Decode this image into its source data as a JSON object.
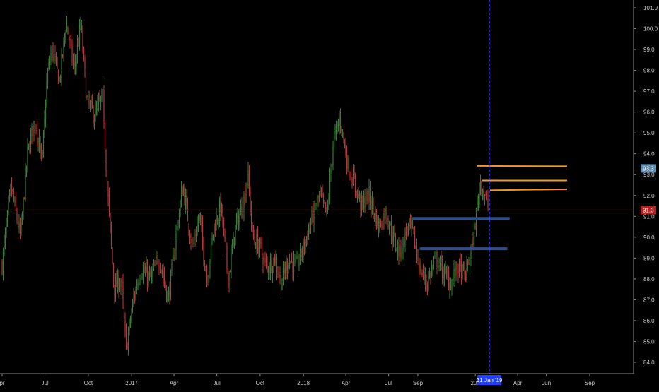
{
  "chart_data": {
    "type": "candlestick",
    "instrument_hint": "",
    "title": "",
    "xlabel": "",
    "ylabel": "",
    "y_range": [
      83.6,
      101.3
    ],
    "x_range": [
      "2016-04-01",
      "2019-09-30"
    ],
    "x_ticks": [
      {
        "label": "pr",
        "date": "2016-04-01"
      },
      {
        "label": "Jul",
        "date": "2016-07-01"
      },
      {
        "label": "Oct",
        "date": "2016-10-01"
      },
      {
        "label": "2017",
        "date": "2017-01-01"
      },
      {
        "label": "Apr",
        "date": "2017-04-01"
      },
      {
        "label": "Jul",
        "date": "2017-07-01"
      },
      {
        "label": "Oct",
        "date": "2017-10-01"
      },
      {
        "label": "2018",
        "date": "2018-01-01"
      },
      {
        "label": "Apr",
        "date": "2018-04-01"
      },
      {
        "label": "Jul",
        "date": "2018-07-01"
      },
      {
        "label": "Sep",
        "date": "2018-09-01"
      },
      {
        "label": "201",
        "date": "2019-01-01"
      },
      {
        "label": "Apr",
        "date": "2019-04-01"
      },
      {
        "label": "Jun",
        "date": "2019-06-01"
      },
      {
        "label": "Sep",
        "date": "2019-09-01"
      }
    ],
    "y_ticks": [
      84.0,
      85.0,
      86.0,
      87.0,
      88.0,
      89.0,
      90.0,
      91.0,
      92.0,
      93.0,
      94.0,
      95.0,
      96.0,
      97.0,
      98.0,
      99.0,
      100.0,
      101.0
    ],
    "price_path": [
      [
        "2016-04-01",
        88.7
      ],
      [
        "2016-04-20",
        92.4
      ],
      [
        "2016-05-10",
        90.0
      ],
      [
        "2016-05-25",
        94.0
      ],
      [
        "2016-06-10",
        95.7
      ],
      [
        "2016-06-25",
        93.5
      ],
      [
        "2016-07-05",
        97.5
      ],
      [
        "2016-07-15",
        99.0
      ],
      [
        "2016-08-01",
        97.5
      ],
      [
        "2016-08-15",
        100.3
      ],
      [
        "2016-09-01",
        98.0
      ],
      [
        "2016-09-15",
        100.2
      ],
      [
        "2016-09-28",
        96.5
      ],
      [
        "2016-10-15",
        95.8
      ],
      [
        "2016-11-01",
        96.8
      ],
      [
        "2016-11-10",
        92.5
      ],
      [
        "2016-11-25",
        87.5
      ],
      [
        "2016-12-10",
        88.0
      ],
      [
        "2016-12-20",
        84.6
      ],
      [
        "2017-01-05",
        87.0
      ],
      [
        "2017-01-20",
        88.5
      ],
      [
        "2017-02-10",
        88.0
      ],
      [
        "2017-03-01",
        89.0
      ],
      [
        "2017-03-20",
        87.0
      ],
      [
        "2017-04-05",
        90.0
      ],
      [
        "2017-04-20",
        92.5
      ],
      [
        "2017-05-10",
        89.5
      ],
      [
        "2017-05-25",
        91.0
      ],
      [
        "2017-06-10",
        88.0
      ],
      [
        "2017-06-25",
        90.5
      ],
      [
        "2017-07-10",
        91.5
      ],
      [
        "2017-07-25",
        88.0
      ],
      [
        "2017-08-10",
        90.5
      ],
      [
        "2017-08-25",
        91.5
      ],
      [
        "2017-09-05",
        93.0
      ],
      [
        "2017-09-15",
        90.0
      ],
      [
        "2017-10-01",
        89.5
      ],
      [
        "2017-10-15",
        88.5
      ],
      [
        "2017-11-01",
        89.0
      ],
      [
        "2017-11-15",
        87.8
      ],
      [
        "2017-12-01",
        89.0
      ],
      [
        "2017-12-15",
        88.5
      ],
      [
        "2018-01-01",
        89.5
      ],
      [
        "2018-01-20",
        91.0
      ],
      [
        "2018-02-05",
        92.0
      ],
      [
        "2018-02-20",
        91.0
      ],
      [
        "2018-03-05",
        94.5
      ],
      [
        "2018-03-20",
        95.7
      ],
      [
        "2018-04-05",
        93.5
      ],
      [
        "2018-04-20",
        92.5
      ],
      [
        "2018-05-05",
        91.5
      ],
      [
        "2018-05-20",
        92.0
      ],
      [
        "2018-06-10",
        90.5
      ],
      [
        "2018-06-25",
        91.3
      ],
      [
        "2018-07-10",
        90.0
      ],
      [
        "2018-07-25",
        89.2
      ],
      [
        "2018-08-10",
        90.5
      ],
      [
        "2018-08-20",
        90.3
      ],
      [
        "2018-09-05",
        88.5
      ],
      [
        "2018-09-20",
        87.8
      ],
      [
        "2018-10-10",
        89.0
      ],
      [
        "2018-10-25",
        88.3
      ],
      [
        "2018-11-10",
        87.8
      ],
      [
        "2018-11-25",
        88.6
      ],
      [
        "2018-12-10",
        88.1
      ],
      [
        "2018-12-25",
        89.5
      ],
      [
        "2019-01-05",
        91.5
      ],
      [
        "2019-01-12",
        92.8
      ],
      [
        "2019-01-20",
        92.0
      ],
      [
        "2019-01-31",
        91.3
      ]
    ],
    "annotations": {
      "current_price": 91.3,
      "current_price_label": "91.3",
      "last_close_label": "93.3",
      "last_close": 93.3,
      "date_cursor_label": "31 Jan '19",
      "date_cursor": "2019-01-31",
      "horizontal_rays": [
        {
          "kind": "resistance",
          "color": "#f7931e",
          "start": "2019-01-05",
          "end": "2019-07-15",
          "y_start": 93.42,
          "y_end": 93.4
        },
        {
          "kind": "resistance",
          "color": "#f7931e",
          "start": "2019-01-15",
          "end": "2019-07-15",
          "y_start": 92.72,
          "y_end": 92.72
        },
        {
          "kind": "resistance",
          "color": "#f7931e",
          "start": "2019-02-01",
          "end": "2019-07-15",
          "y_start": 92.25,
          "y_end": 92.3
        },
        {
          "kind": "support",
          "color": "#2e4d8c",
          "start": "2018-08-20",
          "end": "2019-03-15",
          "y_start": 90.9,
          "y_end": 90.9
        },
        {
          "kind": "support",
          "color": "#2e4d8c",
          "start": "2018-09-05",
          "end": "2019-03-10",
          "y_start": 89.45,
          "y_end": 89.45
        }
      ]
    },
    "colors": {
      "background": "#000000",
      "up_candle": "#3a7a3a",
      "down_candle": "#b03a3a",
      "price_line": "#b22222",
      "date_cursor": "#1f3fff",
      "axis_text": "#c8c8c8",
      "price_tag_bg": "#b22222",
      "close_tag_bg": "#5f8fb4"
    }
  }
}
